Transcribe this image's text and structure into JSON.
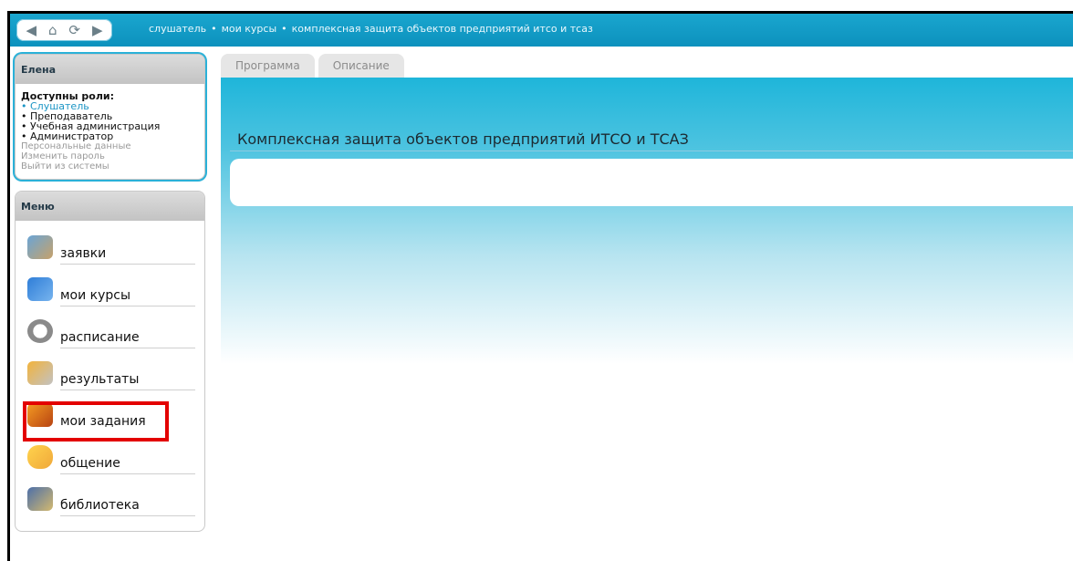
{
  "nav": {
    "back": "◀",
    "home": "⌂",
    "refresh": "⟳",
    "forward": "▶"
  },
  "breadcrumb": [
    "слушатель",
    "мои курсы",
    "комплексная защита объектов предприятий итсо и тсаз"
  ],
  "user_panel": {
    "name": "Елена",
    "roles_title": "Доступны роли:",
    "roles": [
      "Слушатель",
      "Преподаватель",
      "Учебная администрация",
      "Администратор"
    ],
    "active_role": "Слушатель",
    "links": [
      "Персональные данные",
      "Изменить пароль",
      "Выйти из системы"
    ]
  },
  "menu": {
    "title": "Меню",
    "items": [
      {
        "label": "заявки",
        "icon": "requests-icon"
      },
      {
        "label": "мои курсы",
        "icon": "books-icon"
      },
      {
        "label": "расписание",
        "icon": "clock-icon"
      },
      {
        "label": "результаты",
        "icon": "results-icon"
      },
      {
        "label": "мои задания",
        "icon": "tasks-icon"
      },
      {
        "label": "общение",
        "icon": "chat-icon"
      },
      {
        "label": "библиотека",
        "icon": "library-icon"
      }
    ],
    "highlighted_index": 4
  },
  "tabs": [
    "Программа",
    "Описание"
  ],
  "page": {
    "title": "Комплексная защита объектов предприятий ИТСО и ТСАЗ"
  },
  "colors": {
    "accent": "#0c91bd",
    "highlight": "#e30000",
    "active_role": "#1b95c5"
  }
}
